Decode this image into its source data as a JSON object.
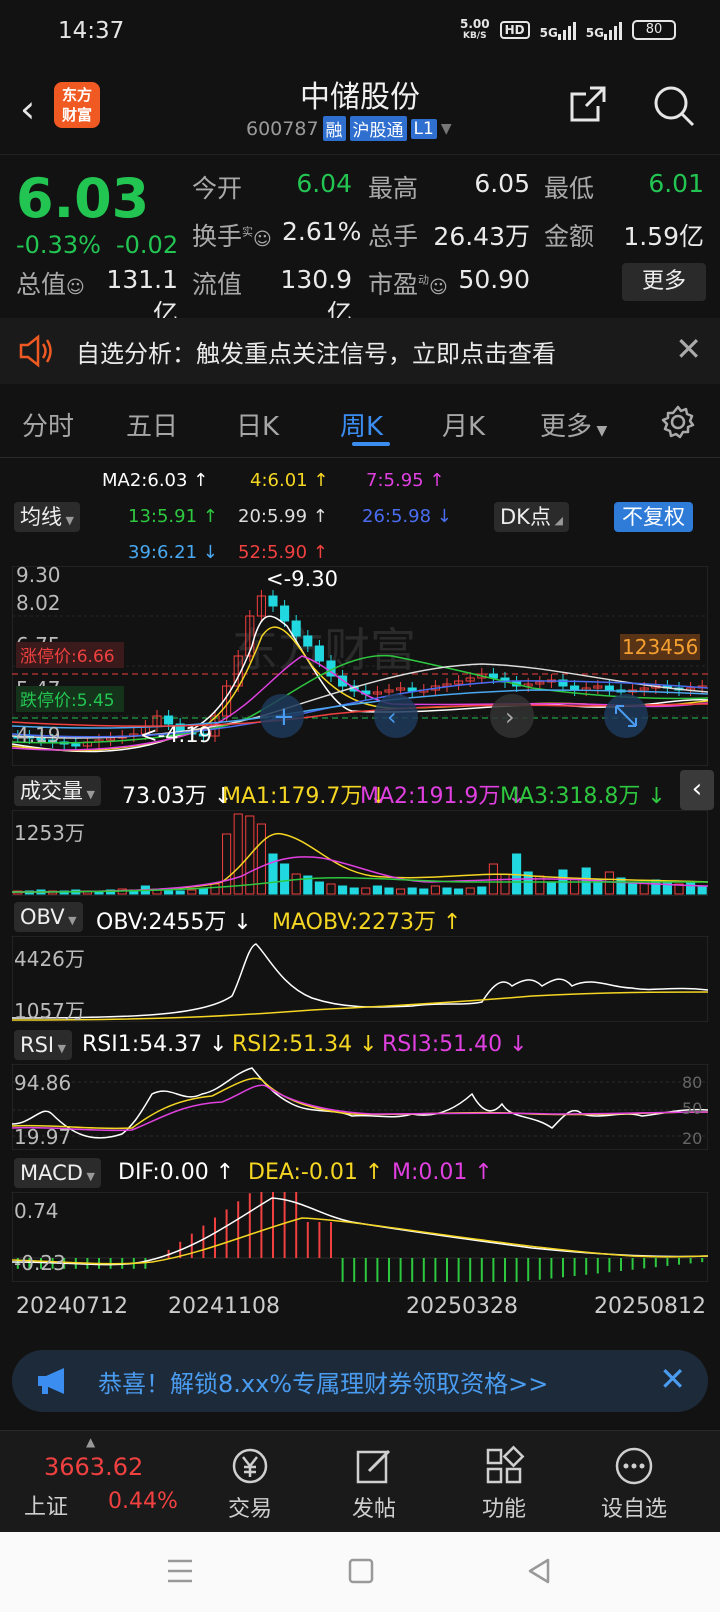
{
  "status": {
    "time": "14:37",
    "speed_value": "5.00",
    "speed_unit": "KB/S",
    "hd": "HD",
    "net1": "5G",
    "net2": "5G",
    "battery": "80"
  },
  "header": {
    "logo": "东方财富",
    "name": "中储股份",
    "code": "600787",
    "tag_rong": "融",
    "tag_hgt": "沪股通",
    "tag_level": "L1"
  },
  "quote": {
    "price": "6.03",
    "change_pct": "-0.33%",
    "change": "-0.02",
    "open_label": "今开",
    "open": "6.04",
    "high_label": "最高",
    "high": "6.05",
    "low_label": "最低",
    "low": "6.01",
    "turnover_label": "换手",
    "turnover_sup": "实",
    "turnover": "2.61%",
    "volume_label": "总手",
    "volume": "26.43万",
    "amount_label": "金额",
    "amount": "1.59亿",
    "mktcap_label": "总值",
    "mktcap": "131.1亿",
    "float_label": "流值",
    "float": "130.9亿",
    "pe_label": "市盈",
    "pe_sup": "动",
    "pe": "50.90",
    "more": "更多"
  },
  "banner": {
    "text": "自选分析：触发重点关注信号，立即点击查看"
  },
  "tabs": [
    "分时",
    "五日",
    "日K",
    "周K",
    "月K",
    "更多"
  ],
  "chart": {
    "ma_button": "均线",
    "dk_button": "DK点",
    "fq_button": "不复权",
    "ma_legend": [
      {
        "text": "MA2:6.03 ↑",
        "color": "#ffffff"
      },
      {
        "text": "4:6.01 ↑",
        "color": "#f5d623"
      },
      {
        "text": "7:5.95 ↑",
        "color": "#e040e0"
      },
      {
        "text": "13:5.91 ↑",
        "color": "#2ec840"
      },
      {
        "text": "20:5.99 ↑",
        "color": "#dddddd"
      },
      {
        "text": "26:5.98 ↓",
        "color": "#4a6cf0"
      },
      {
        "text": "39:6.21 ↓",
        "color": "#4aa8f0"
      },
      {
        "text": "52:5.90 ↑",
        "color": "#f04040"
      }
    ],
    "price_axis": [
      "9.30",
      "8.02",
      "6.75",
      "5.47",
      "4.19"
    ],
    "limit_up": "涨停价:6.66",
    "limit_down": "跌停价:5.45",
    "high_mark": "<-9.30",
    "low_mark": "<-4.19",
    "dk_nums": "123456",
    "watermark": "东方财富"
  },
  "volume": {
    "label": "成交量",
    "values": [
      {
        "text": "73.03万 ↓",
        "color": "#ffffff"
      },
      {
        "text": "MA1:179.7万 ↓",
        "color": "#f5d623"
      },
      {
        "text": "MA2:191.9万 ↓",
        "color": "#e040e0"
      },
      {
        "text": "MA3:318.8万 ↓",
        "color": "#2ec840"
      }
    ],
    "axis": "1253万"
  },
  "obv": {
    "label": "OBV",
    "values": [
      {
        "text": "OBV:2455万 ↓",
        "color": "#ffffff"
      },
      {
        "text": "MAOBV:2273万 ↑",
        "color": "#f5d623"
      }
    ],
    "axis_top": "4426万",
    "axis_bottom": "1057万"
  },
  "rsi": {
    "label": "RSI",
    "values": [
      {
        "text": "RSI1:54.37 ↓",
        "color": "#ffffff"
      },
      {
        "text": "RSI2:51.34 ↓",
        "color": "#f5d623"
      },
      {
        "text": "RSI3:51.40 ↓",
        "color": "#e040e0"
      }
    ],
    "axis_top": "94.86",
    "axis_bottom": "19.97",
    "right_80": "80",
    "right_50": "50",
    "right_20": "20"
  },
  "macd": {
    "label": "MACD",
    "values": [
      {
        "text": "DIF:0.00 ↑",
        "color": "#ffffff"
      },
      {
        "text": "DEA:-0.01 ↑",
        "color": "#f5d623"
      },
      {
        "text": "M:0.01 ↑",
        "color": "#e040e0"
      }
    ],
    "axis_top": "0.74",
    "axis_bottom": "-0.23"
  },
  "dates": [
    "20240712",
    "20241108",
    "20250328",
    "20250812"
  ],
  "promo": {
    "text": "恭喜！解锁8.xx%专属理财券领取资格>>"
  },
  "toolbar": {
    "index_value": "3663.62",
    "index_name": "上证",
    "index_pct": "0.44%",
    "trade": "交易",
    "post": "发帖",
    "func": "功能",
    "watch": "设自选"
  },
  "colors": {
    "up": "#f04040",
    "down": "#23c552",
    "accent": "#3b8df0"
  }
}
